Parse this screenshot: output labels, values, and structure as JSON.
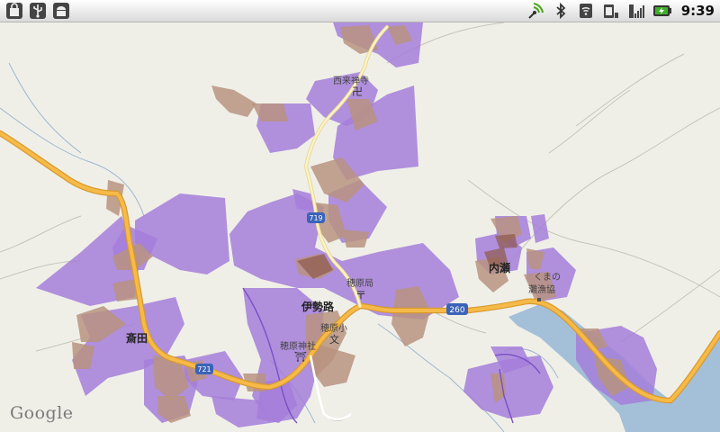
{
  "status_bar": {
    "time": "9:39",
    "left_icons": [
      "shopping-bag-icon",
      "usb-icon",
      "android-debug-icon"
    ],
    "right_icons": [
      "gps-signal-icon",
      "bluetooth-icon",
      "wifi-icon",
      "sim-icon",
      "cell-signal-icon",
      "battery-charging-icon"
    ]
  },
  "map": {
    "labels": {
      "saiji": "西来禅寺",
      "ise": "伊勢路",
      "uchise": "内瀬",
      "saida": "斎田",
      "post": "穂原局",
      "school": "穂原小",
      "shrine": "穂原神社",
      "kumano_1": "くまの",
      "kumano_2": "灘漁協"
    },
    "route_shields": {
      "r260": "260",
      "r719": "719",
      "r721": "721"
    },
    "attribution": "Google"
  },
  "colors": {
    "land": "#efefe8",
    "water": "#a4bfd8",
    "overlay_purple": "#a57ed9",
    "overlay_brown": "#b99380",
    "road_major": "#f6ba48"
  }
}
